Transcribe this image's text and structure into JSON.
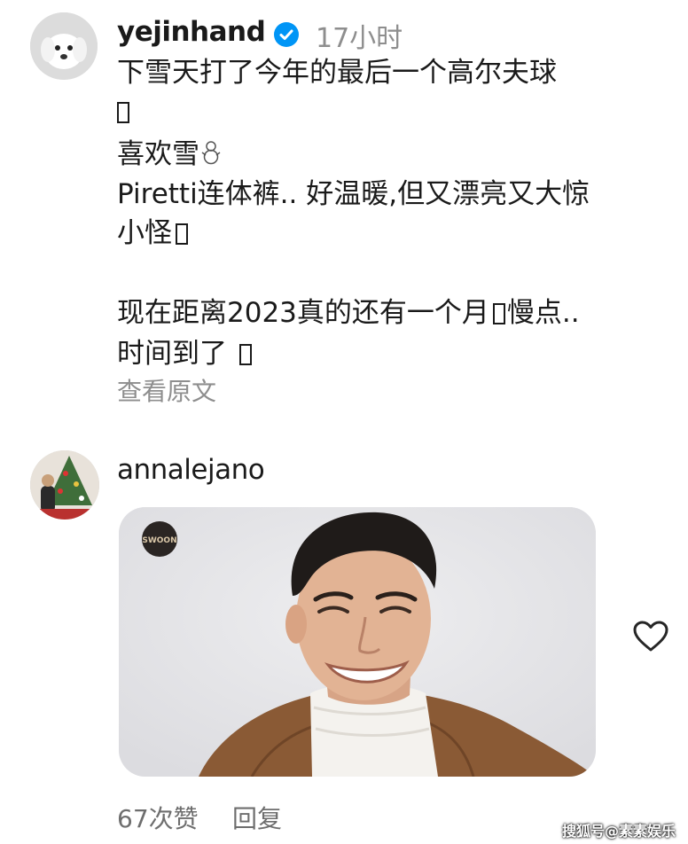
{
  "comment1": {
    "username": "yejinhand",
    "timestamp": "17小时",
    "lines": [
      "下雪天打了今年的最后一个高尔夫球",
      "",
      "喜欢雪",
      "Piretti连体裤.. 好温暖,但又漂亮又大惊",
      "小怪",
      "现在距离2023真的还有一个月",
      "慢点..",
      "时间到了 "
    ],
    "see_original": "查看原文",
    "avatar_icon": "white-puppy-avatar"
  },
  "comment2": {
    "username": "annalejano",
    "avatar_icon": "christmas-tree-avatar",
    "photo_logo": "SWOON",
    "likes": "67次赞",
    "reply": "回复",
    "like_icon": "heart-outline-icon"
  },
  "watermark": "搜狐号@素素娱乐",
  "colors": {
    "text": "#1a1a1a",
    "muted": "#8e8e8e",
    "verified": "#0095f6",
    "card_bg": "#e6e6e8",
    "sweater": "#8a5a35"
  }
}
